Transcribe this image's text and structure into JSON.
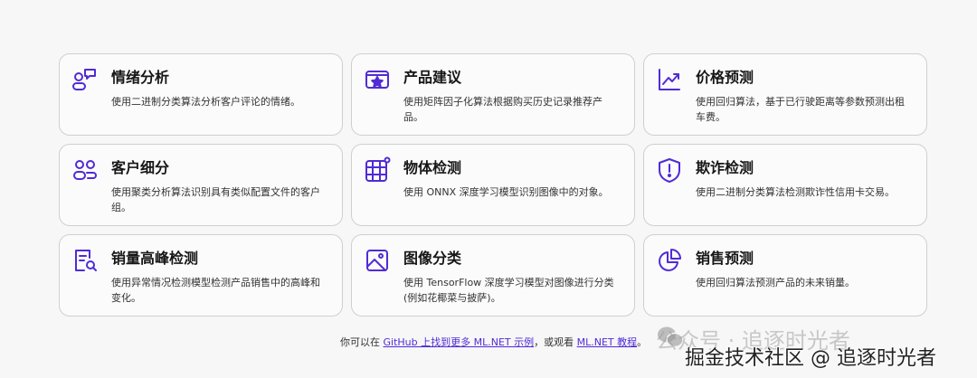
{
  "cards": [
    {
      "icon": "people-chat-icon",
      "title": "情绪分析",
      "desc": "使用二进制分类算法分析客户评论的情绪。"
    },
    {
      "icon": "product-star-icon",
      "title": "产品建议",
      "desc": "使用矩阵因子化算法根据购买历史记录推荐产品。"
    },
    {
      "icon": "trend-chart-icon",
      "title": "价格预测",
      "desc": "使用回归算法，基于已行驶距离等参数预测出租车费。"
    },
    {
      "icon": "people-group-icon",
      "title": "客户细分",
      "desc": "使用聚类分析算法识别具有类似配置文件的客户组。"
    },
    {
      "icon": "grid-detect-icon",
      "title": "物体检测",
      "desc": "使用 ONNX 深度学习模型识别图像中的对象。"
    },
    {
      "icon": "shield-alert-icon",
      "title": "欺诈检测",
      "desc": "使用二进制分类算法检测欺诈性信用卡交易。"
    },
    {
      "icon": "document-search-icon",
      "title": "销量高峰检测",
      "desc": "使用异常情况检测模型检测产品销售中的高峰和变化。"
    },
    {
      "icon": "image-icon",
      "title": "图像分类",
      "desc": "使用 TensorFlow 深度学习模型对图像进行分类(例如花椰菜与披萨)。"
    },
    {
      "icon": "pie-chart-icon",
      "title": "销售预测",
      "desc": "使用回归算法预测产品的未来销量。"
    }
  ],
  "footer": {
    "prefix": "你可以在 ",
    "link1": "GitHub 上找到更多 ML.NET 示例",
    "middle": "，或观看 ",
    "link2": "ML.NET 教程",
    "suffix": "。"
  },
  "watermark": {
    "line1": "公众号 · 追逐时光者",
    "line2": "掘金技术社区 @ 追逐时光者"
  }
}
